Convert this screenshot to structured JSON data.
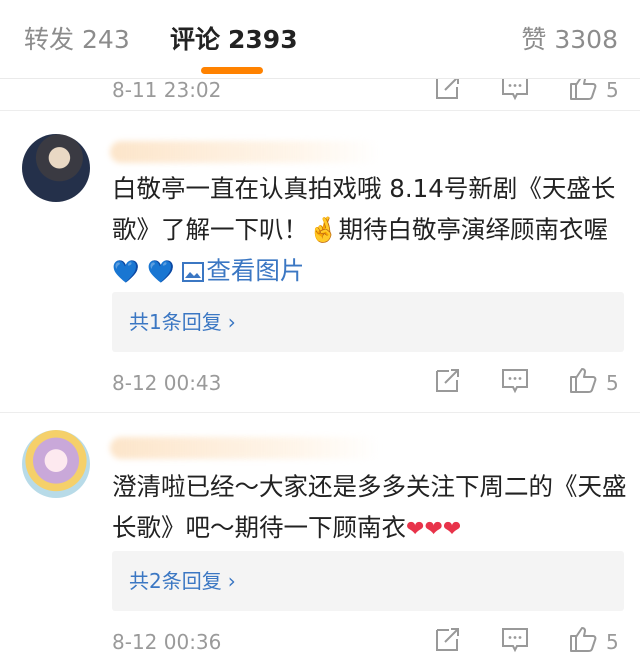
{
  "tabs": {
    "repost": {
      "label": "转发",
      "count": "243"
    },
    "comments": {
      "label": "评论",
      "count": "2393"
    },
    "likes": {
      "label": "赞",
      "count": "3308"
    }
  },
  "accent_color": "#ff8200",
  "link_color": "#3b77c3",
  "comments": [
    {
      "time": "8-11 23:02",
      "likes": "5"
    },
    {
      "text_main": "白敬亭一直在认真拍戏哦 8.14号新剧《天盛长歌》了解一下叭！",
      "emoji": "🤞",
      "text_tail": "期待白敬亭演绎顾南衣喔",
      "hearts": [
        "💙",
        "💙"
      ],
      "link": "查看图片",
      "replies": "共1条回复",
      "time": "8-12 00:43",
      "likes": "5"
    },
    {
      "text": "澄清啦已经～大家还是多多关注下周二的《天盛长歌》吧～期待一下顾南衣",
      "hearts": [
        "❤",
        "❤",
        "❤"
      ],
      "replies": "共2条回复",
      "time": "8-12 00:36",
      "likes": "5"
    }
  ],
  "icons": {
    "share": "share-icon",
    "reply": "comment-icon",
    "like": "thumbs-up-icon",
    "image": "image-icon",
    "chevron": "chevron-right-icon"
  }
}
